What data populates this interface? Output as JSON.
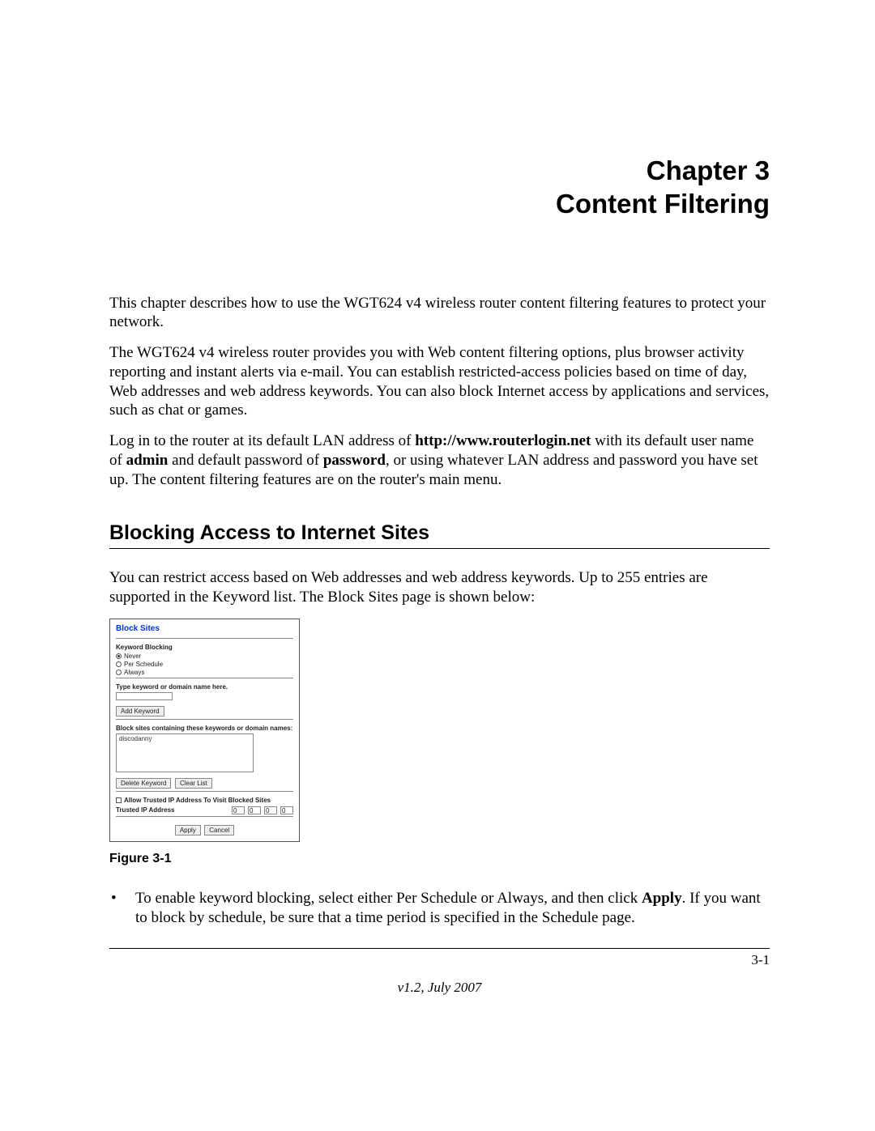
{
  "chapter": {
    "line1": "Chapter 3",
    "line2": "Content Filtering"
  },
  "paragraphs": {
    "p1": "This chapter describes how to use the WGT624 v4 wireless router content filtering features to protect your network.",
    "p2": "The WGT624 v4 wireless router provides you with Web content filtering options, plus browser activity reporting and instant alerts via e-mail. You can establish restricted-access policies based on time of day, Web addresses and web address keywords. You can also block Internet access by applications and services, such as chat or games.",
    "p3a": "Log in to the router at its default LAN address of ",
    "p3_url": "http://www.routerlogin.net",
    "p3b": " with its default user name of ",
    "p3_admin": "admin",
    "p3c": " and default password of ",
    "p3_pw": "password",
    "p3d": ", or using whatever LAN address and password you have set up. The content filtering features are on the router's main menu."
  },
  "section_heading": "Blocking Access to Internet Sites",
  "section_intro": "You can restrict access based on Web addresses and web address keywords. Up to 255 entries are supported in the Keyword list. The Block Sites page is shown below:",
  "figure": {
    "title": "Block Sites",
    "keyword_blocking_label": "Keyword Blocking",
    "radio_never": "Never",
    "radio_per_schedule": "Per Schedule",
    "radio_always": "Always",
    "type_label": "Type keyword or domain name here.",
    "add_keyword_btn": "Add Keyword",
    "list_label": "Block sites containing these keywords or domain names:",
    "list_entry": "discodanny",
    "delete_btn": "Delete Keyword",
    "clear_btn": "Clear List",
    "allow_checkbox": "Allow Trusted IP Address To Visit Blocked Sites",
    "trusted_ip_label": "Trusted IP Address",
    "octet": "0",
    "apply_btn": "Apply",
    "cancel_btn": "Cancel",
    "caption": "Figure 3-1"
  },
  "bullet": {
    "text_a": "To enable keyword blocking, select either Per Schedule or Always, and then click ",
    "text_apply": "Apply",
    "text_b": ". If you want to block by schedule, be sure that a time period is specified in the Schedule page."
  },
  "footer": {
    "page": "3-1",
    "version": "v1.2, July 2007"
  }
}
